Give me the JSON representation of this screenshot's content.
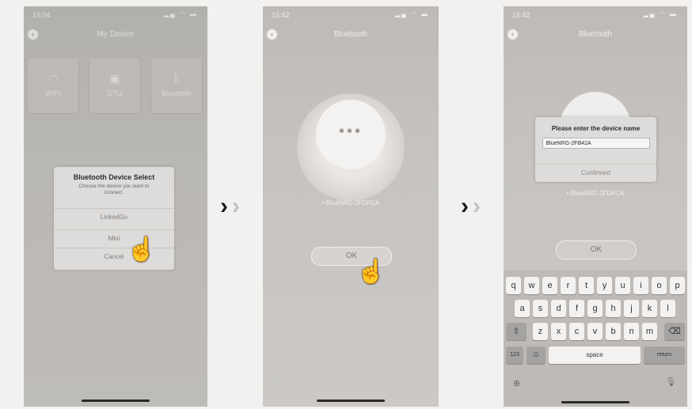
{
  "screens": {
    "device": {
      "time": "15:04",
      "title": "My Device",
      "tiles": [
        {
          "label": "WIFI",
          "icon": "wifi-icon"
        },
        {
          "label": "DTU",
          "icon": "dtu-icon"
        },
        {
          "label": "Bluetooth",
          "icon": "bluetooth-icon"
        }
      ],
      "dialog": {
        "title": "Bluetooth Device Select",
        "subtitle": "Choose the device you want to connect.",
        "options": [
          "LinkedGo",
          "Mini",
          "Cancel"
        ]
      }
    },
    "bluetooth": {
      "time": "15:42",
      "title": "Bluetooth",
      "device_name": "• BlueNRG-2FDFCA",
      "ok_label": "OK"
    },
    "rename": {
      "time": "15:42",
      "title": "Bluetooth",
      "dialog": {
        "title": "Please enter the device name",
        "input_value": "BlueNRG-2FB42A",
        "button": "Confirmed"
      },
      "device_name": "• BlueNRG-2FDFCA",
      "ok_label": "OK",
      "keyboard": {
        "row1": [
          "q",
          "w",
          "e",
          "r",
          "t",
          "y",
          "u",
          "i",
          "o",
          "p"
        ],
        "row2": [
          "a",
          "s",
          "d",
          "f",
          "g",
          "h",
          "j",
          "k",
          "l"
        ],
        "row3": [
          "z",
          "x",
          "c",
          "v",
          "b",
          "n",
          "m"
        ],
        "num_label": "123",
        "space_label": "space",
        "return_label": "return"
      }
    }
  }
}
